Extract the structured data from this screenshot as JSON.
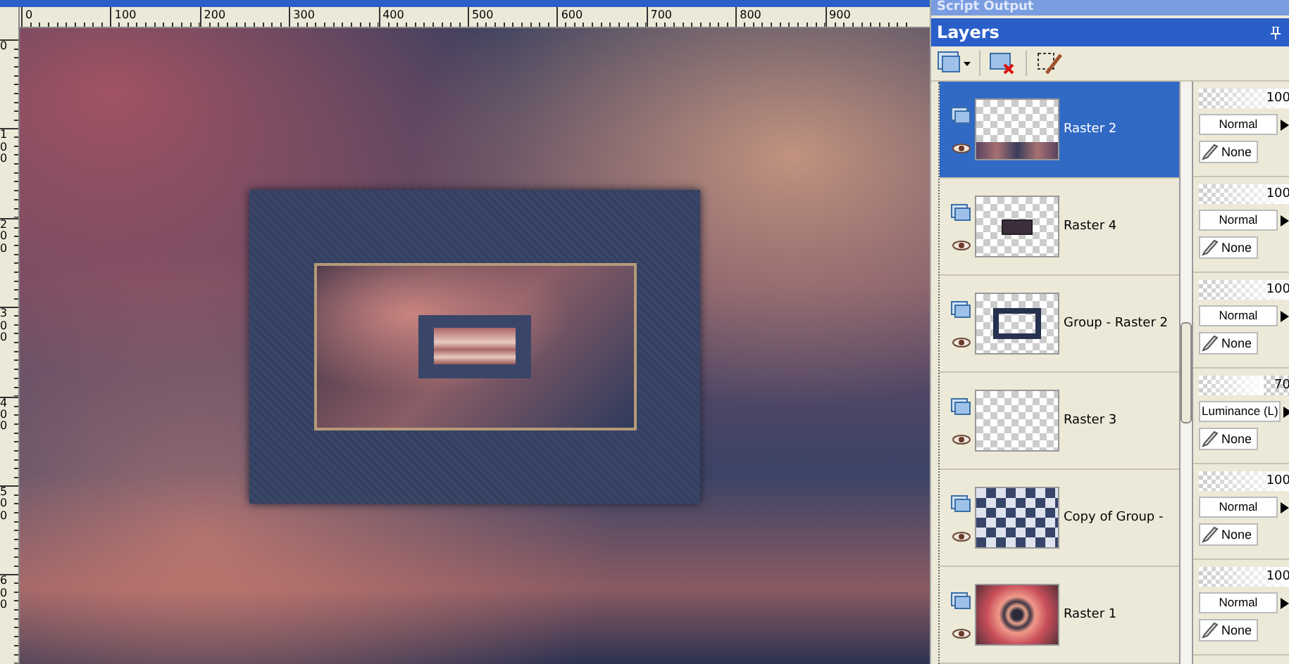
{
  "rulers": {
    "horizontal": [
      "0",
      "100",
      "200",
      "300",
      "400",
      "500",
      "600",
      "700",
      "800",
      "900"
    ],
    "vertical": [
      "0",
      "100",
      "200",
      "300",
      "400",
      "500",
      "600"
    ]
  },
  "script_output": {
    "title": "Script Output"
  },
  "layers_panel": {
    "title": "Layers",
    "layers": [
      {
        "name": "Raster 2",
        "kind": "floor",
        "selected": true,
        "visible": true,
        "opacity": "100",
        "level": 1,
        "blend_mode": "Normal",
        "blend_range": "None"
      },
      {
        "name": "Raster 4",
        "kind": "inset",
        "selected": false,
        "visible": true,
        "opacity": "100",
        "level": 1,
        "blend_mode": "Normal",
        "blend_range": "None"
      },
      {
        "name": "Group - Raster 2",
        "kind": "frame",
        "selected": false,
        "visible": true,
        "opacity": "100",
        "level": 1,
        "blend_mode": "Normal",
        "blend_range": "None"
      },
      {
        "name": "Raster 3",
        "kind": "empty",
        "selected": false,
        "visible": true,
        "opacity": "70",
        "level": 0.7,
        "blend_mode": "Luminance (L)",
        "blend_range": "None"
      },
      {
        "name": "Copy of Group -",
        "kind": "pattern",
        "selected": false,
        "visible": true,
        "opacity": "100",
        "level": 1,
        "blend_mode": "Normal",
        "blend_range": "None"
      },
      {
        "name": "Raster 1",
        "kind": "swirl",
        "selected": false,
        "visible": true,
        "opacity": "100",
        "level": 1,
        "blend_mode": "Normal",
        "blend_range": "None"
      }
    ]
  }
}
